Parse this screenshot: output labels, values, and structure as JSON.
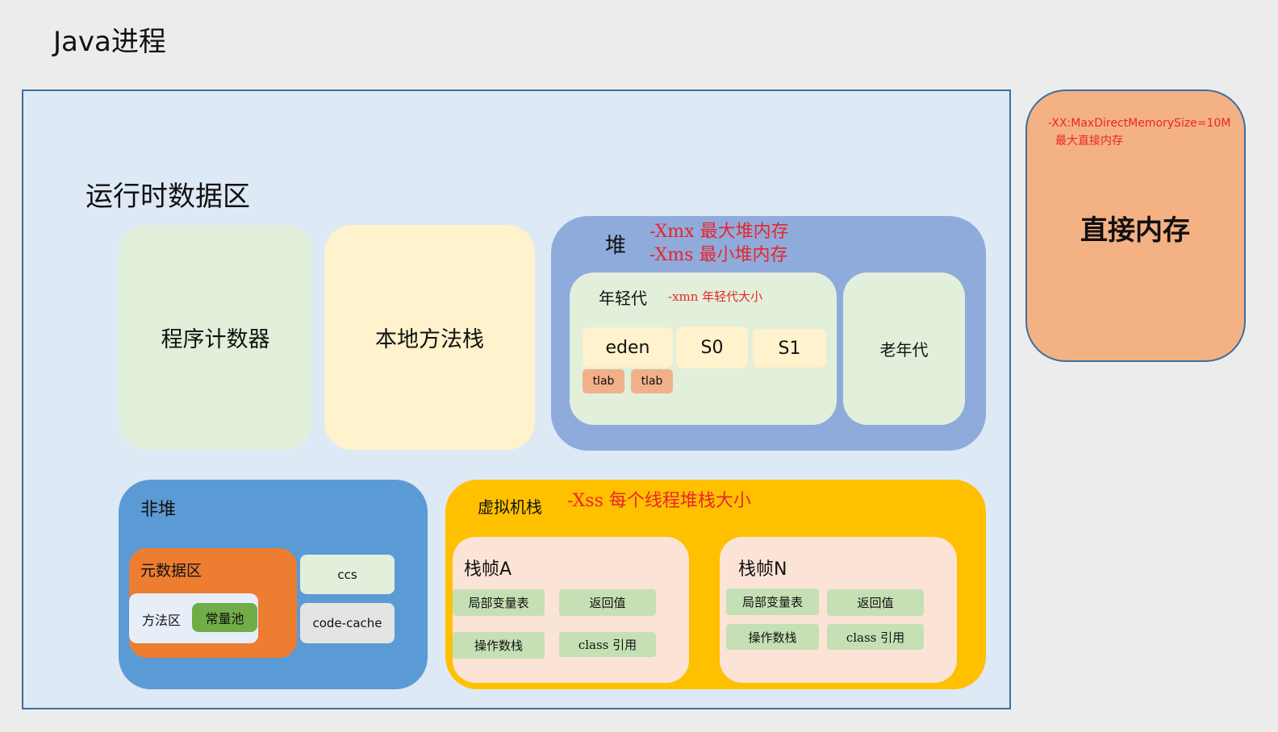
{
  "title": "Java进程",
  "runtime_area": {
    "title": "运行时数据区"
  },
  "program_counter": "程序计数器",
  "native_method_stack": "本地方法栈",
  "heap": {
    "title": "堆",
    "note_max": "-Xmx 最大堆内存",
    "note_min": "-Xms 最小堆内存",
    "young": {
      "title": "年轻代",
      "note": "-xmn 年轻代大小",
      "eden": "eden",
      "s0": "S0",
      "s1": "S1",
      "tlabs": [
        "tlab",
        "tlab"
      ]
    },
    "old": "老年代"
  },
  "non_heap": {
    "title": "非堆",
    "metaspace": {
      "title": "元数据区",
      "method_area": "方法区",
      "constant_pool": "常量池"
    },
    "ccs": "ccs",
    "code_cache": "code-cache"
  },
  "vm_stack": {
    "title": "虚拟机栈",
    "note": "-Xss 每个线程堆栈大小",
    "frames": [
      {
        "title": "栈帧A",
        "locals": "局部变量表",
        "return_value": "返回值",
        "operand_stack": "操作数栈",
        "class_ref": "class 引用"
      },
      {
        "title": "栈帧N",
        "locals": "局部变量表",
        "return_value": "返回值",
        "operand_stack": "操作数栈",
        "class_ref": "class 引用"
      }
    ]
  },
  "direct_memory": {
    "note_param": "-XX:MaxDirectMemorySize=10M",
    "note_desc": "最大直接内存",
    "title": "直接内存"
  },
  "colors": {
    "runtime_bg": "#dde9f5",
    "heap_bg": "#8fabdc",
    "non_heap_bg": "#5b9bd5",
    "metaspace_bg": "#ed7d31",
    "vm_stack_bg": "#ffc000",
    "direct_memory_bg": "#f4b183",
    "note_red": "#e8262a"
  }
}
